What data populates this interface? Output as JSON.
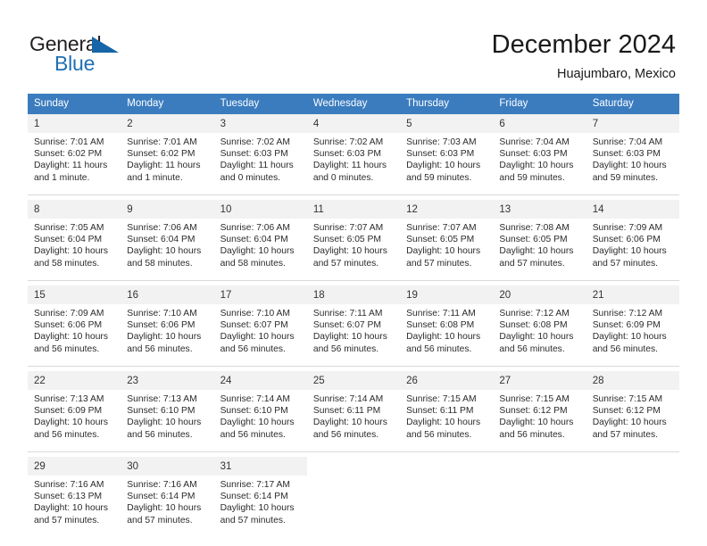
{
  "brand": {
    "name_part1": "General",
    "name_part2": "Blue",
    "triangle_icon": "triangle-icon",
    "primary_color": "#1f6fb5",
    "dark_color": "#231f20"
  },
  "header": {
    "title": "December 2024",
    "subtitle": "Huajumbaro, Mexico"
  },
  "calendar": {
    "header_bg": "#3b7cbf",
    "daynum_bg": "#f2f2f2",
    "weekdays": [
      "Sunday",
      "Monday",
      "Tuesday",
      "Wednesday",
      "Thursday",
      "Friday",
      "Saturday"
    ],
    "weeks": [
      [
        {
          "day": "1",
          "sunrise": "Sunrise: 7:01 AM",
          "sunset": "Sunset: 6:02 PM",
          "daylight_1": "Daylight: 11 hours",
          "daylight_2": "and 1 minute."
        },
        {
          "day": "2",
          "sunrise": "Sunrise: 7:01 AM",
          "sunset": "Sunset: 6:02 PM",
          "daylight_1": "Daylight: 11 hours",
          "daylight_2": "and 1 minute."
        },
        {
          "day": "3",
          "sunrise": "Sunrise: 7:02 AM",
          "sunset": "Sunset: 6:03 PM",
          "daylight_1": "Daylight: 11 hours",
          "daylight_2": "and 0 minutes."
        },
        {
          "day": "4",
          "sunrise": "Sunrise: 7:02 AM",
          "sunset": "Sunset: 6:03 PM",
          "daylight_1": "Daylight: 11 hours",
          "daylight_2": "and 0 minutes."
        },
        {
          "day": "5",
          "sunrise": "Sunrise: 7:03 AM",
          "sunset": "Sunset: 6:03 PM",
          "daylight_1": "Daylight: 10 hours",
          "daylight_2": "and 59 minutes."
        },
        {
          "day": "6",
          "sunrise": "Sunrise: 7:04 AM",
          "sunset": "Sunset: 6:03 PM",
          "daylight_1": "Daylight: 10 hours",
          "daylight_2": "and 59 minutes."
        },
        {
          "day": "7",
          "sunrise": "Sunrise: 7:04 AM",
          "sunset": "Sunset: 6:03 PM",
          "daylight_1": "Daylight: 10 hours",
          "daylight_2": "and 59 minutes."
        }
      ],
      [
        {
          "day": "8",
          "sunrise": "Sunrise: 7:05 AM",
          "sunset": "Sunset: 6:04 PM",
          "daylight_1": "Daylight: 10 hours",
          "daylight_2": "and 58 minutes."
        },
        {
          "day": "9",
          "sunrise": "Sunrise: 7:06 AM",
          "sunset": "Sunset: 6:04 PM",
          "daylight_1": "Daylight: 10 hours",
          "daylight_2": "and 58 minutes."
        },
        {
          "day": "10",
          "sunrise": "Sunrise: 7:06 AM",
          "sunset": "Sunset: 6:04 PM",
          "daylight_1": "Daylight: 10 hours",
          "daylight_2": "and 58 minutes."
        },
        {
          "day": "11",
          "sunrise": "Sunrise: 7:07 AM",
          "sunset": "Sunset: 6:05 PM",
          "daylight_1": "Daylight: 10 hours",
          "daylight_2": "and 57 minutes."
        },
        {
          "day": "12",
          "sunrise": "Sunrise: 7:07 AM",
          "sunset": "Sunset: 6:05 PM",
          "daylight_1": "Daylight: 10 hours",
          "daylight_2": "and 57 minutes."
        },
        {
          "day": "13",
          "sunrise": "Sunrise: 7:08 AM",
          "sunset": "Sunset: 6:05 PM",
          "daylight_1": "Daylight: 10 hours",
          "daylight_2": "and 57 minutes."
        },
        {
          "day": "14",
          "sunrise": "Sunrise: 7:09 AM",
          "sunset": "Sunset: 6:06 PM",
          "daylight_1": "Daylight: 10 hours",
          "daylight_2": "and 57 minutes."
        }
      ],
      [
        {
          "day": "15",
          "sunrise": "Sunrise: 7:09 AM",
          "sunset": "Sunset: 6:06 PM",
          "daylight_1": "Daylight: 10 hours",
          "daylight_2": "and 56 minutes."
        },
        {
          "day": "16",
          "sunrise": "Sunrise: 7:10 AM",
          "sunset": "Sunset: 6:06 PM",
          "daylight_1": "Daylight: 10 hours",
          "daylight_2": "and 56 minutes."
        },
        {
          "day": "17",
          "sunrise": "Sunrise: 7:10 AM",
          "sunset": "Sunset: 6:07 PM",
          "daylight_1": "Daylight: 10 hours",
          "daylight_2": "and 56 minutes."
        },
        {
          "day": "18",
          "sunrise": "Sunrise: 7:11 AM",
          "sunset": "Sunset: 6:07 PM",
          "daylight_1": "Daylight: 10 hours",
          "daylight_2": "and 56 minutes."
        },
        {
          "day": "19",
          "sunrise": "Sunrise: 7:11 AM",
          "sunset": "Sunset: 6:08 PM",
          "daylight_1": "Daylight: 10 hours",
          "daylight_2": "and 56 minutes."
        },
        {
          "day": "20",
          "sunrise": "Sunrise: 7:12 AM",
          "sunset": "Sunset: 6:08 PM",
          "daylight_1": "Daylight: 10 hours",
          "daylight_2": "and 56 minutes."
        },
        {
          "day": "21",
          "sunrise": "Sunrise: 7:12 AM",
          "sunset": "Sunset: 6:09 PM",
          "daylight_1": "Daylight: 10 hours",
          "daylight_2": "and 56 minutes."
        }
      ],
      [
        {
          "day": "22",
          "sunrise": "Sunrise: 7:13 AM",
          "sunset": "Sunset: 6:09 PM",
          "daylight_1": "Daylight: 10 hours",
          "daylight_2": "and 56 minutes."
        },
        {
          "day": "23",
          "sunrise": "Sunrise: 7:13 AM",
          "sunset": "Sunset: 6:10 PM",
          "daylight_1": "Daylight: 10 hours",
          "daylight_2": "and 56 minutes."
        },
        {
          "day": "24",
          "sunrise": "Sunrise: 7:14 AM",
          "sunset": "Sunset: 6:10 PM",
          "daylight_1": "Daylight: 10 hours",
          "daylight_2": "and 56 minutes."
        },
        {
          "day": "25",
          "sunrise": "Sunrise: 7:14 AM",
          "sunset": "Sunset: 6:11 PM",
          "daylight_1": "Daylight: 10 hours",
          "daylight_2": "and 56 minutes."
        },
        {
          "day": "26",
          "sunrise": "Sunrise: 7:15 AM",
          "sunset": "Sunset: 6:11 PM",
          "daylight_1": "Daylight: 10 hours",
          "daylight_2": "and 56 minutes."
        },
        {
          "day": "27",
          "sunrise": "Sunrise: 7:15 AM",
          "sunset": "Sunset: 6:12 PM",
          "daylight_1": "Daylight: 10 hours",
          "daylight_2": "and 56 minutes."
        },
        {
          "day": "28",
          "sunrise": "Sunrise: 7:15 AM",
          "sunset": "Sunset: 6:12 PM",
          "daylight_1": "Daylight: 10 hours",
          "daylight_2": "and 57 minutes."
        }
      ],
      [
        {
          "day": "29",
          "sunrise": "Sunrise: 7:16 AM",
          "sunset": "Sunset: 6:13 PM",
          "daylight_1": "Daylight: 10 hours",
          "daylight_2": "and 57 minutes."
        },
        {
          "day": "30",
          "sunrise": "Sunrise: 7:16 AM",
          "sunset": "Sunset: 6:14 PM",
          "daylight_1": "Daylight: 10 hours",
          "daylight_2": "and 57 minutes."
        },
        {
          "day": "31",
          "sunrise": "Sunrise: 7:17 AM",
          "sunset": "Sunset: 6:14 PM",
          "daylight_1": "Daylight: 10 hours",
          "daylight_2": "and 57 minutes."
        },
        {
          "day": "",
          "sunrise": "",
          "sunset": "",
          "daylight_1": "",
          "daylight_2": ""
        },
        {
          "day": "",
          "sunrise": "",
          "sunset": "",
          "daylight_1": "",
          "daylight_2": ""
        },
        {
          "day": "",
          "sunrise": "",
          "sunset": "",
          "daylight_1": "",
          "daylight_2": ""
        },
        {
          "day": "",
          "sunrise": "",
          "sunset": "",
          "daylight_1": "",
          "daylight_2": ""
        }
      ]
    ]
  }
}
